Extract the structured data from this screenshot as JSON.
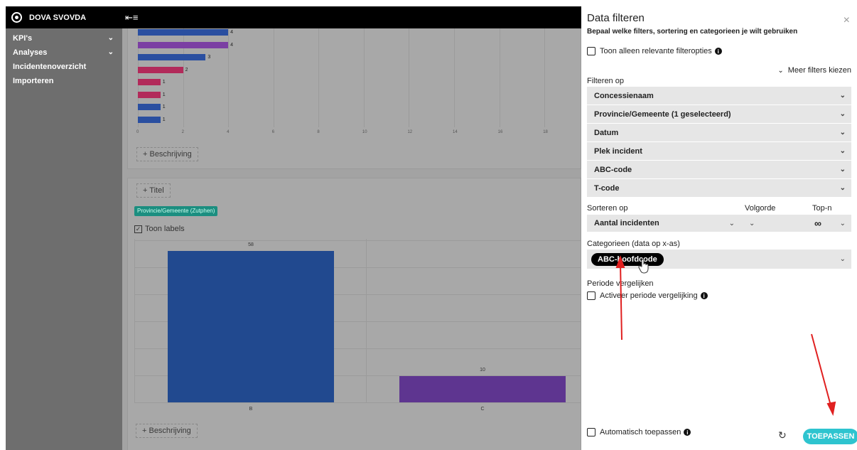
{
  "app": {
    "brand": "DOVA SVOVDA",
    "menu_toggle": "⇤≡"
  },
  "sidebar": {
    "items": [
      {
        "label": "KPI's",
        "has_chevron": true
      },
      {
        "label": "Analyses",
        "has_chevron": true
      },
      {
        "label": "Incidentenoverzicht",
        "has_chevron": false
      },
      {
        "label": "Importeren",
        "has_chevron": false
      }
    ],
    "chevron": "⌄"
  },
  "chart_data": [
    {
      "type": "bar",
      "orientation": "horizontal",
      "values": [
        4,
        4,
        3,
        2,
        1,
        1,
        1,
        1
      ],
      "bar_colors": [
        "#2a4fa0",
        "#7b3fa3",
        "#2a4fa0",
        "#b22a5a",
        "#b22a5a",
        "#b22a5a",
        "#2a4fa0",
        "#2a4fa0"
      ],
      "x_ticks": [
        "0",
        "2",
        "4",
        "6",
        "8",
        "10",
        "12",
        "14",
        "16",
        "18"
      ],
      "xlim": [
        0,
        19
      ]
    },
    {
      "type": "bar",
      "categories": [
        "B",
        "C"
      ],
      "values": [
        58,
        10
      ],
      "bar_colors": [
        "#21498f",
        "#5e3590"
      ],
      "ylim": [
        0,
        62
      ]
    }
  ],
  "main": {
    "add_description": "+ Beschrijving",
    "add_title": "+ Titel",
    "filter_tag": "Provincie/Gemeente (Zutphen)",
    "show_labels": "Toon labels"
  },
  "panel": {
    "title": "Data filteren",
    "subtitle": "Bepaal welke filters, sortering en categorieen je wilt gebruiken",
    "close": "×",
    "relevant_only": "Toon alleen relevante filteropties",
    "more_filters": "Meer filters kiezen",
    "filter_by": "Filteren op",
    "filters": [
      "Concessienaam",
      "Provincie/Gemeente (1 geselecteerd)",
      "Datum",
      "Plek incident",
      "ABC-code",
      "T-code"
    ],
    "sort_by": "Sorteren op",
    "order_label": "Volgorde",
    "topn_label": "Top-n",
    "sort_value": "Aantal incidenten",
    "topn_value": "∞",
    "categories_label": "Categorieen (data op x-as)",
    "category_pill": "ABC-hoofdcode",
    "compare_period": "Periode vergelijken",
    "activate_compare": "Activeer periode vergelijking",
    "auto_apply": "Automatisch toepassen",
    "apply": "TOEPASSEN",
    "refresh_icon": "↻",
    "info_icon": "i",
    "chevron": "⌄"
  },
  "colors": {
    "accent": "#2ec4cf",
    "topbar": "#000000",
    "sidebar": "#6e6e6e",
    "arrow": "#e02020"
  }
}
